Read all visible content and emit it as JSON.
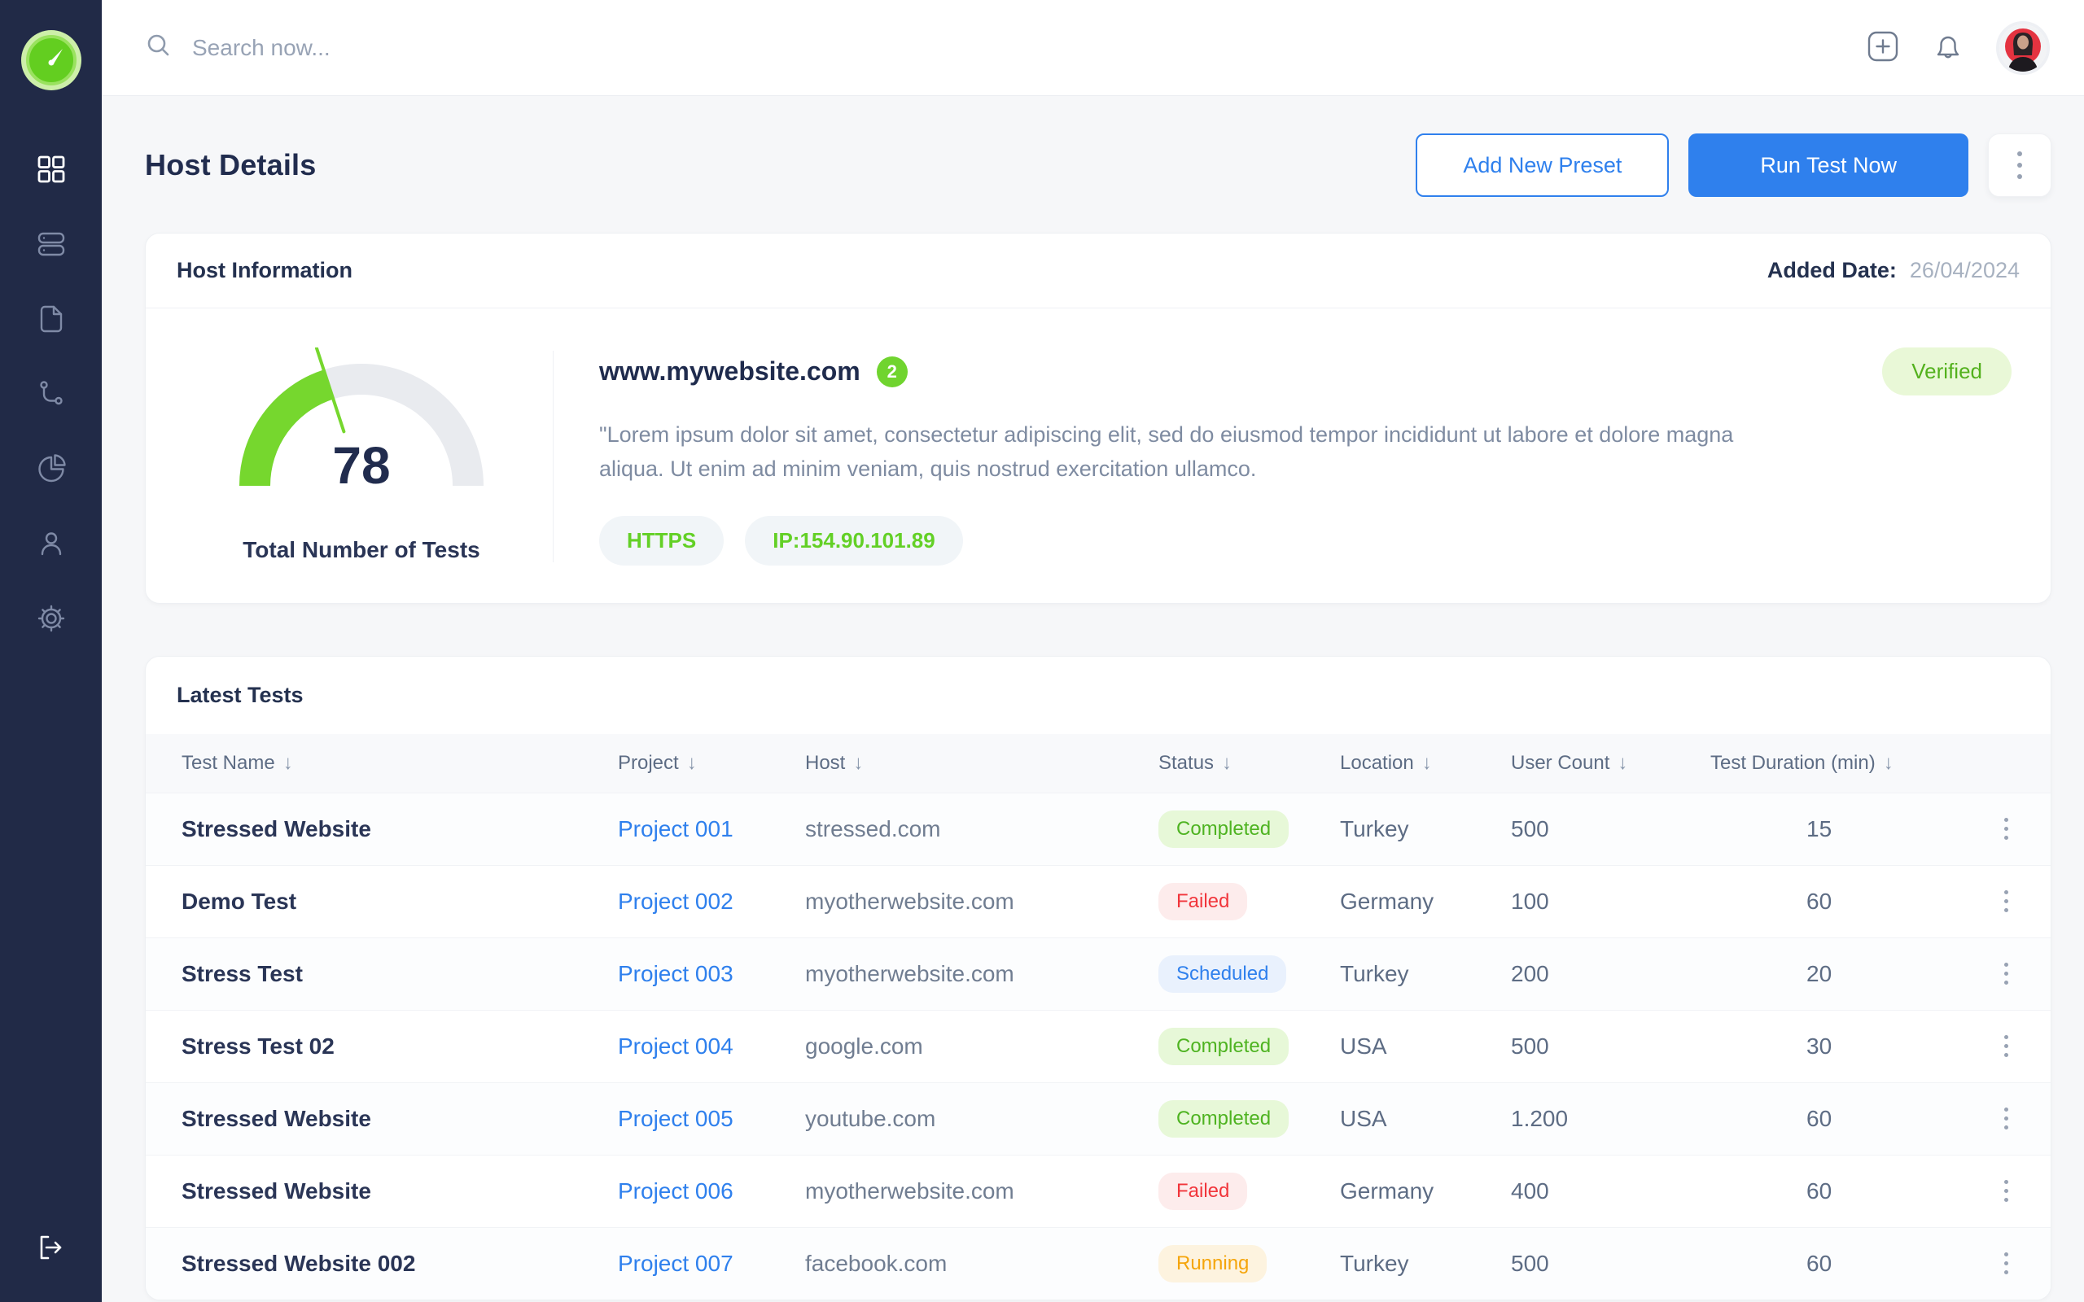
{
  "colors": {
    "sidebar_bg": "#212A47",
    "accent_blue": "#2F80ED",
    "brand_green": "#70D42F",
    "status_green": "#4EB321",
    "status_red": "#F1353B",
    "status_orange": "#F5A50B",
    "avatar_red": "#E43340"
  },
  "sidebar": {
    "logo_icon": "speedometer-logo",
    "items": [
      {
        "icon": "grid-icon",
        "active": true
      },
      {
        "icon": "server-icon",
        "active": false
      },
      {
        "icon": "document-icon",
        "active": false
      },
      {
        "icon": "git-branch-icon",
        "active": false
      },
      {
        "icon": "pie-chart-icon",
        "active": false
      },
      {
        "icon": "user-icon",
        "active": false
      },
      {
        "icon": "gear-icon",
        "active": false
      }
    ],
    "logout_icon": "logout-icon"
  },
  "topbar": {
    "search_placeholder": "Search now...",
    "right_icons": [
      "add-square-icon",
      "bell-icon",
      "avatar"
    ]
  },
  "page": {
    "title": "Host Details",
    "actions": {
      "add_preset": "Add New Preset",
      "run_test": "Run Test Now"
    }
  },
  "host_info": {
    "title": "Host Information",
    "added_date_label": "Added Date:",
    "added_date": "26/04/2024",
    "gauge": {
      "value": "78",
      "label": "Total Number of Tests",
      "percent_filled": 40
    },
    "domain": "www.mywebsite.com",
    "domain_badge_count": "2",
    "verified_label": "Verified",
    "description": "\"Lorem ipsum dolor sit amet, consectetur adipiscing elit, sed do eiusmod tempor incididunt ut labore et dolore magna aliqua. Ut enim ad minim veniam, quis nostrud exercitation ullamco.",
    "tags": [
      "HTTPS",
      "IP:154.90.101.89"
    ]
  },
  "latest_tests": {
    "title": "Latest Tests",
    "columns": [
      "Test Name",
      "Project",
      "Host",
      "Status",
      "Location",
      "User Count",
      "Test Duration (min)"
    ],
    "rows": [
      {
        "test_name": "Stressed Website",
        "project": "Project 001",
        "host": "stressed.com",
        "status": "Completed",
        "status_type": "completed",
        "location": "Turkey",
        "user_count": "500",
        "duration": "15"
      },
      {
        "test_name": "Demo Test",
        "project": "Project 002",
        "host": "myotherwebsite.com",
        "status": "Failed",
        "status_type": "failed",
        "location": "Germany",
        "user_count": "100",
        "duration": "60"
      },
      {
        "test_name": "Stress Test",
        "project": "Project 003",
        "host": "myotherwebsite.com",
        "status": "Scheduled",
        "status_type": "scheduled",
        "location": "Turkey",
        "user_count": "200",
        "duration": "20"
      },
      {
        "test_name": "Stress Test 02",
        "project": "Project 004",
        "host": "google.com",
        "status": "Completed",
        "status_type": "completed",
        "location": "USA",
        "user_count": "500",
        "duration": "30"
      },
      {
        "test_name": "Stressed Website",
        "project": "Project 005",
        "host": "youtube.com",
        "status": "Completed",
        "status_type": "completed",
        "location": "USA",
        "user_count": "1.200",
        "duration": "60"
      },
      {
        "test_name": "Stressed Website",
        "project": "Project 006",
        "host": "myotherwebsite.com",
        "status": "Failed",
        "status_type": "failed",
        "location": "Germany",
        "user_count": "400",
        "duration": "60"
      },
      {
        "test_name": "Stressed Website 002",
        "project": "Project 007",
        "host": "facebook.com",
        "status": "Running",
        "status_type": "running",
        "location": "Turkey",
        "user_count": "500",
        "duration": "60"
      }
    ]
  }
}
